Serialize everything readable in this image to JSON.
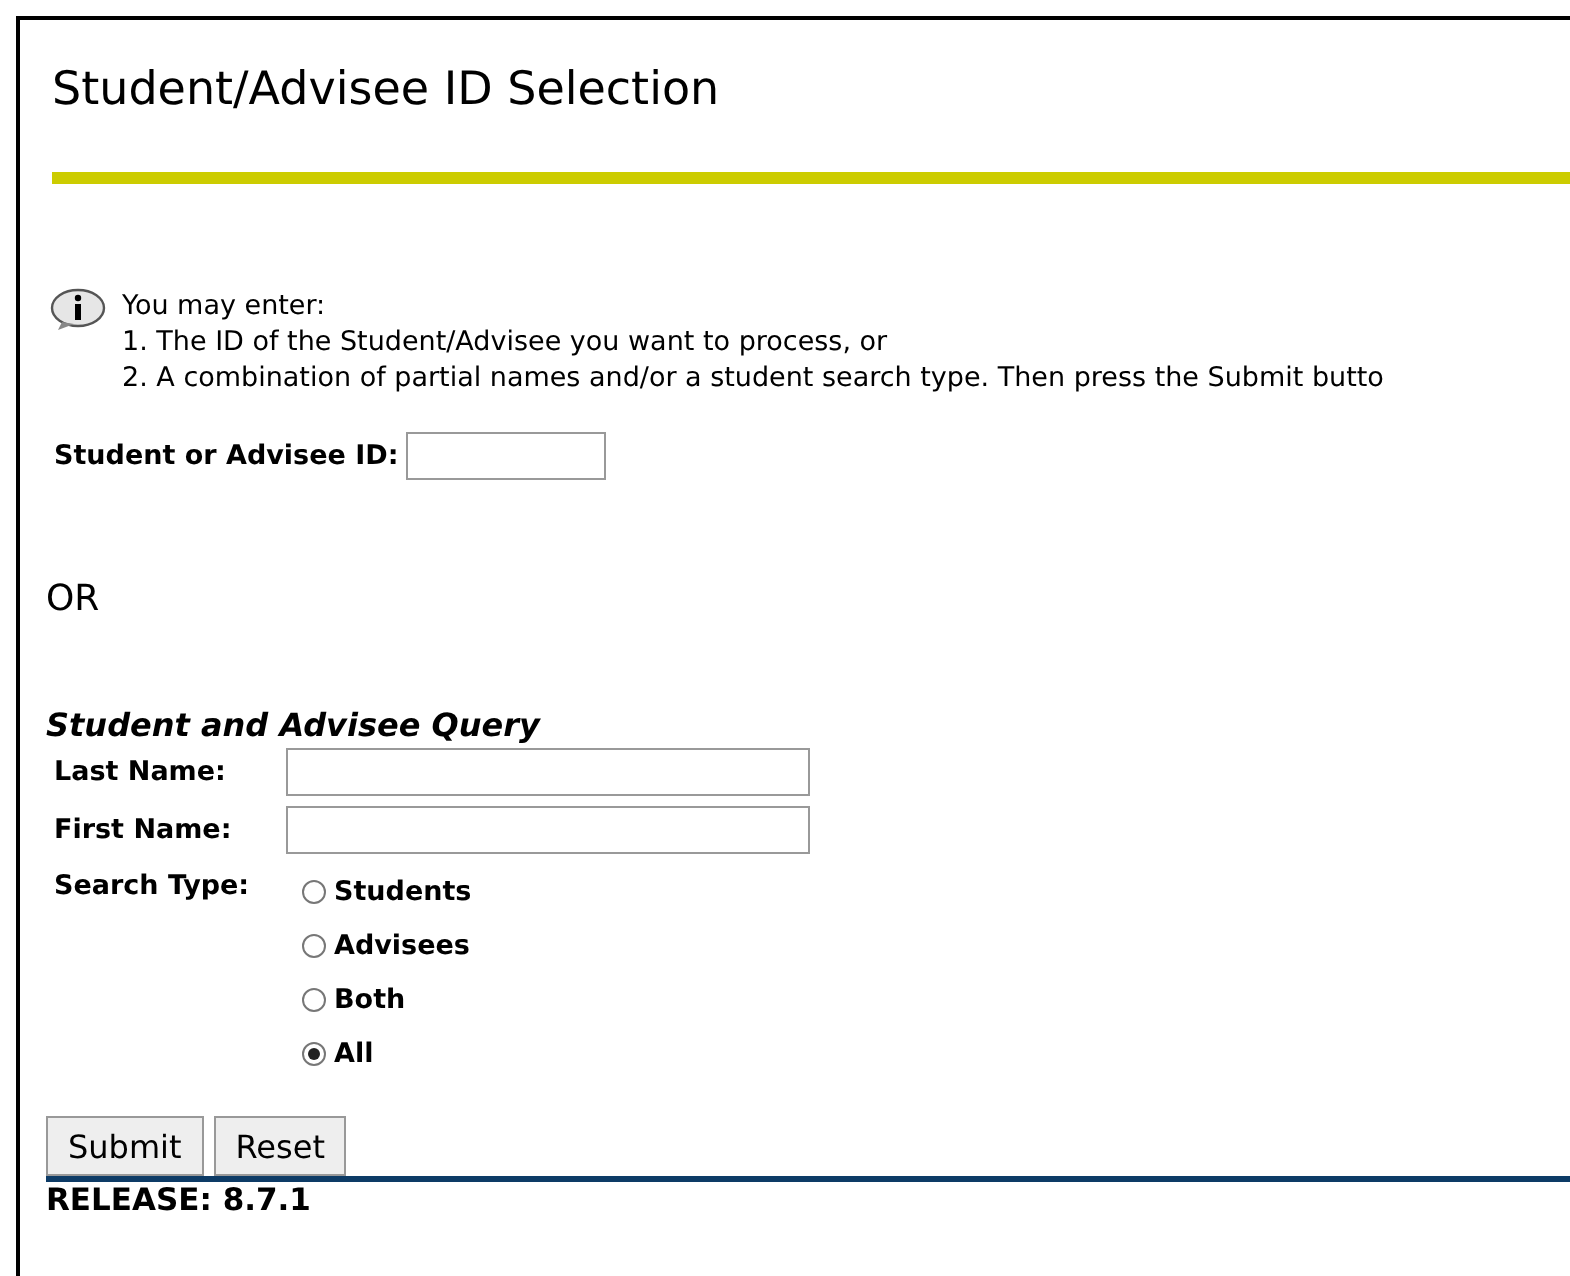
{
  "title": "Student/Advisee ID Selection",
  "info": {
    "intro": "You may enter:",
    "lines": [
      "1. The ID of the Student/Advisee you want to process, or",
      "2. A combination of partial names and/or a student search type. Then press the Submit butto"
    ]
  },
  "id_field": {
    "label": "Student or Advisee ID:"
  },
  "separator": "OR",
  "query": {
    "heading": "Student and Advisee Query",
    "fields": [
      {
        "label": "Last Name:"
      },
      {
        "label": "First Name:"
      }
    ],
    "search_type": {
      "label": "Search Type:",
      "options": [
        {
          "label": "Students",
          "selected": false
        },
        {
          "label": "Advisees",
          "selected": false
        },
        {
          "label": "Both",
          "selected": false
        },
        {
          "label": "All",
          "selected": true
        }
      ]
    }
  },
  "buttons": [
    "Submit",
    "Reset"
  ],
  "release": "RELEASE: 8.7.1"
}
